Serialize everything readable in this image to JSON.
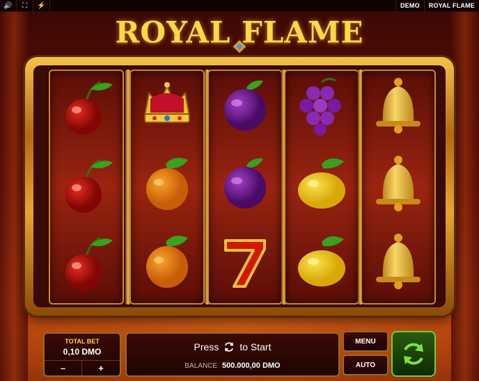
{
  "topbar": {
    "sound_icon": "speaker-icon",
    "fullscreen_icon": "fullscreen-icon",
    "turbo_icon": "lightning-off-icon",
    "mode_label": "DEMO",
    "game_label": "ROYAL FLAME"
  },
  "title": "ROYAL FLAME",
  "reels": [
    [
      "cherry",
      "cherry",
      "cherry"
    ],
    [
      "crown",
      "orange",
      "orange"
    ],
    [
      "plum",
      "plum",
      "seven"
    ],
    [
      "grapes",
      "lemon",
      "lemon"
    ],
    [
      "bell",
      "bell",
      "bell"
    ]
  ],
  "controls": {
    "total_bet_label": "TOTAL BET",
    "total_bet_value": "0,10 DMO",
    "minus_label": "–",
    "plus_label": "+",
    "press_text": "Press",
    "press_text_after": "to Start",
    "balance_label": "BALANCE",
    "balance_value": "500.000,00 DMO",
    "menu_label": "MENU",
    "auto_label": "AUTO",
    "spin_icon": "spin-arrows-icon"
  },
  "colors": {
    "gold": "#ffd84a",
    "spin_green": "#6ad038",
    "panel_bg": "#2a0805"
  }
}
